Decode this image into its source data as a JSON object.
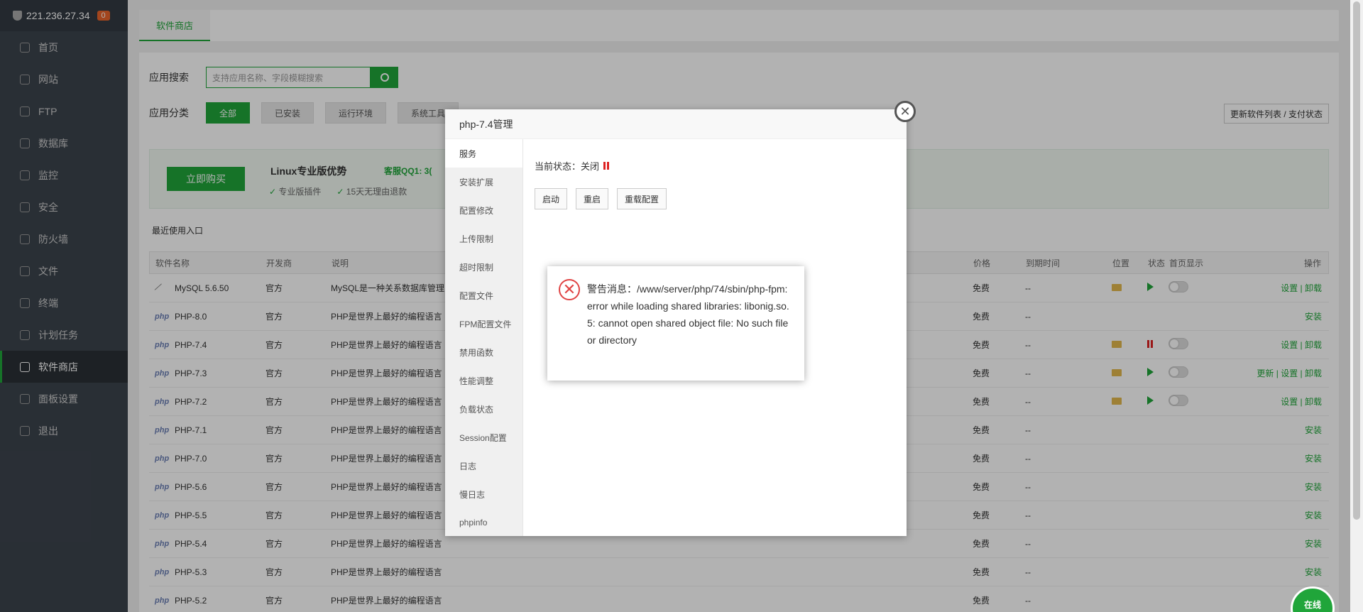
{
  "sidebar": {
    "host": "221.236.27.34",
    "badge": "0",
    "items": [
      {
        "label": "首页",
        "icon": "home-icon"
      },
      {
        "label": "网站",
        "icon": "globe-icon"
      },
      {
        "label": "FTP",
        "icon": "ftp-icon"
      },
      {
        "label": "数据库",
        "icon": "database-icon"
      },
      {
        "label": "监控",
        "icon": "monitor-icon"
      },
      {
        "label": "安全",
        "icon": "shield-icon"
      },
      {
        "label": "防火墙",
        "icon": "firewall-icon"
      },
      {
        "label": "文件",
        "icon": "folder-icon"
      },
      {
        "label": "终端",
        "icon": "terminal-icon"
      },
      {
        "label": "计划任务",
        "icon": "clock-icon"
      },
      {
        "label": "软件商店",
        "icon": "grid-icon",
        "active": true
      },
      {
        "label": "面板设置",
        "icon": "gear-icon"
      },
      {
        "label": "退出",
        "icon": "logout-icon"
      }
    ]
  },
  "tab": {
    "label": "软件商店"
  },
  "search": {
    "label": "应用搜索",
    "placeholder": "支持应用名称、字段模糊搜索"
  },
  "categories": {
    "label": "应用分类",
    "items": [
      "全部",
      "已安装",
      "运行环境",
      "系统工具"
    ]
  },
  "update_button": "更新软件列表 / 支付状态",
  "promo": {
    "buy": "立即购买",
    "title": "Linux专业版优势",
    "qq": "客服QQ1: 3(",
    "features": [
      "专业版插件",
      "15天无理由退款"
    ]
  },
  "recent_label": "最近使用入口",
  "table": {
    "headers": [
      "软件名称",
      "开发商",
      "说明",
      "价格",
      "到期时间",
      "位置",
      "状态",
      "首页显示",
      "操作"
    ],
    "rows": [
      {
        "name": "MySQL 5.6.50",
        "dev": "官方",
        "desc": "MySQL是一种关系数据库管理",
        "price": "免费",
        "expire": "--",
        "ops": "设置 | 卸载"
      },
      {
        "name": "PHP-8.0",
        "dev": "官方",
        "desc": "PHP是世界上最好的编程语言",
        "price": "免费",
        "expire": "--",
        "ops": "安装"
      },
      {
        "name": "PHP-7.4",
        "dev": "官方",
        "desc": "PHP是世界上最好的编程语言",
        "price": "免费",
        "expire": "--",
        "ops": "设置 | 卸载"
      },
      {
        "name": "PHP-7.3",
        "dev": "官方",
        "desc": "PHP是世界上最好的编程语言",
        "price": "免费",
        "expire": "--",
        "ops": "更新 | 设置 | 卸载"
      },
      {
        "name": "PHP-7.2",
        "dev": "官方",
        "desc": "PHP是世界上最好的编程语言",
        "price": "免费",
        "expire": "--",
        "ops": "设置 | 卸载"
      },
      {
        "name": "PHP-7.1",
        "dev": "官方",
        "desc": "PHP是世界上最好的编程语言",
        "price": "免费",
        "expire": "--",
        "ops": "安装"
      },
      {
        "name": "PHP-7.0",
        "dev": "官方",
        "desc": "PHP是世界上最好的编程语言",
        "price": "免费",
        "expire": "--",
        "ops": "安装"
      },
      {
        "name": "PHP-5.6",
        "dev": "官方",
        "desc": "PHP是世界上最好的编程语言",
        "price": "免费",
        "expire": "--",
        "ops": "安装"
      },
      {
        "name": "PHP-5.5",
        "dev": "官方",
        "desc": "PHP是世界上最好的编程语言",
        "price": "免费",
        "expire": "--",
        "ops": "安装"
      },
      {
        "name": "PHP-5.4",
        "dev": "官方",
        "desc": "PHP是世界上最好的编程语言",
        "price": "免费",
        "expire": "--",
        "ops": "安装"
      },
      {
        "name": "PHP-5.3",
        "dev": "官方",
        "desc": "PHP是世界上最好的编程语言",
        "price": "免费",
        "expire": "--",
        "ops": "安装"
      },
      {
        "name": "PHP-5.2",
        "dev": "官方",
        "desc": "PHP是世界上最好的编程语言",
        "price": "免费",
        "expire": "--",
        "ops": "安装"
      }
    ]
  },
  "modal": {
    "title": "php-7.4管理",
    "side": [
      "服务",
      "安装扩展",
      "配置修改",
      "上传限制",
      "超时限制",
      "配置文件",
      "FPM配置文件",
      "禁用函数",
      "性能调整",
      "负载状态",
      "Session配置",
      "日志",
      "慢日志",
      "phpinfo"
    ],
    "status_label": "当前状态：关闭",
    "buttons": [
      "启动",
      "重启",
      "重载配置"
    ]
  },
  "alert": {
    "message": "警告消息：/www/server/php/74/sbin/php-fpm: error while loading shared libraries: libonig.so.5: cannot open shared object file: No such file or directory"
  },
  "chat": "在线",
  "colors": {
    "accent": "#20a53a",
    "sidebar": "#3c444d",
    "error": "#e04545"
  }
}
